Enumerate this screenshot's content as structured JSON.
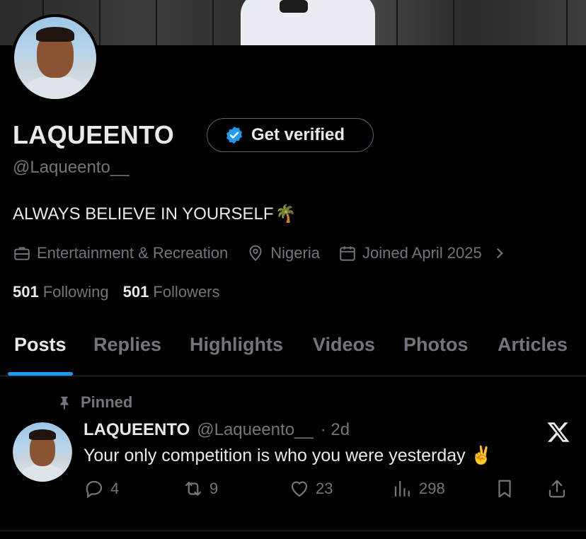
{
  "profile": {
    "display_name": "LAQUEENTO",
    "handle": "@Laqueento__",
    "bio": "ALWAYS BELIEVE IN YOURSELF",
    "bio_emoji": "🌴",
    "get_verified_label": "Get verified",
    "category": "Entertainment & Recreation",
    "location": "Nigeria",
    "joined": "Joined April 2025",
    "following_count": "501",
    "following_label": "Following",
    "followers_count": "501",
    "followers_label": "Followers"
  },
  "tabs": [
    {
      "label": "Posts",
      "active": true
    },
    {
      "label": "Replies"
    },
    {
      "label": "Highlights"
    },
    {
      "label": "Videos"
    },
    {
      "label": "Photos"
    },
    {
      "label": "Articles"
    }
  ],
  "post": {
    "pinned_label": "Pinned",
    "author_name": "LAQUEENTO",
    "author_handle": "@Laqueento__",
    "time": "· 2d",
    "text": "Your only competition is who you were yesterday",
    "text_emoji": "✌️",
    "replies": "4",
    "reposts": "9",
    "likes": "23",
    "views": "298"
  },
  "colors": {
    "background": "#000000",
    "text_primary": "#e7e9ea",
    "text_secondary": "#71767b",
    "accent": "#1d9bf0",
    "border": "#2f3336"
  },
  "icons": {
    "verified": "verified-badge-icon",
    "category": "briefcase-icon",
    "location": "location-pin-icon",
    "joined": "calendar-icon",
    "pin": "pin-icon",
    "reply": "reply-icon",
    "repost": "repost-icon",
    "like": "heart-icon",
    "views": "views-icon",
    "bookmark": "bookmark-icon",
    "share": "share-icon",
    "brand": "x-logo-icon"
  }
}
